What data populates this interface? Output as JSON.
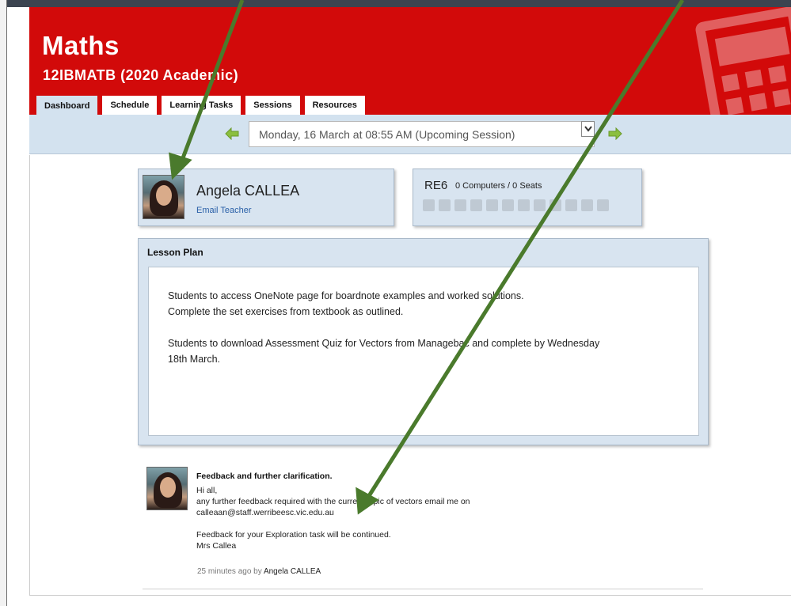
{
  "header": {
    "title": "Maths",
    "subtitle": "12IBMATB (2020 Academic)",
    "brand_color": "#d20a0a"
  },
  "tabs": [
    {
      "label": "Dashboard",
      "active": true
    },
    {
      "label": "Schedule",
      "active": false
    },
    {
      "label": "Learning Tasks",
      "active": false
    },
    {
      "label": "Sessions",
      "active": false
    },
    {
      "label": "Resources",
      "active": false
    }
  ],
  "session_nav": {
    "selected_session": "Monday, 16 March at 08:55 AM (Upcoming Session)",
    "prev_icon": "arrow-left-icon",
    "next_icon": "arrow-right-icon"
  },
  "teacher": {
    "name": "Angela CALLEA",
    "email_label": "Email Teacher"
  },
  "room": {
    "code": "RE6",
    "info": "0 Computers / 0 Seats",
    "facility_icons": [
      "projector-icon",
      "bulb-icon",
      "speaker-icon",
      "pen-icon",
      "keyboard-icon",
      "globe-icon",
      "water-icon",
      "moon-icon",
      "circle-icon",
      "camera-icon",
      "wheelchair-icon",
      "help-icon"
    ]
  },
  "lesson_plan": {
    "heading": "Lesson Plan",
    "lines": [
      "Students to access OneNote page for boardnote examples and worked solutions.",
      "Complete the set exercises from textbook as outlined.",
      "",
      "Students to download Assessment Quiz for Vectors from Managebac and complete by Wednesday",
      "18th March."
    ]
  },
  "feedback": {
    "title": "Feedback and further clarification.",
    "lines": [
      "Hi all,",
      "any further feedback required with the current topic of vectors email me on",
      "calleaan@staff.werribeesc.vic.edu.au",
      "",
      "Feedback for your Exploration task will be continued.",
      "Mrs Callea"
    ],
    "time_ago": "25 minutes ago by",
    "author": "Angela CALLEA"
  },
  "annotation_color": "#4a7a2c"
}
